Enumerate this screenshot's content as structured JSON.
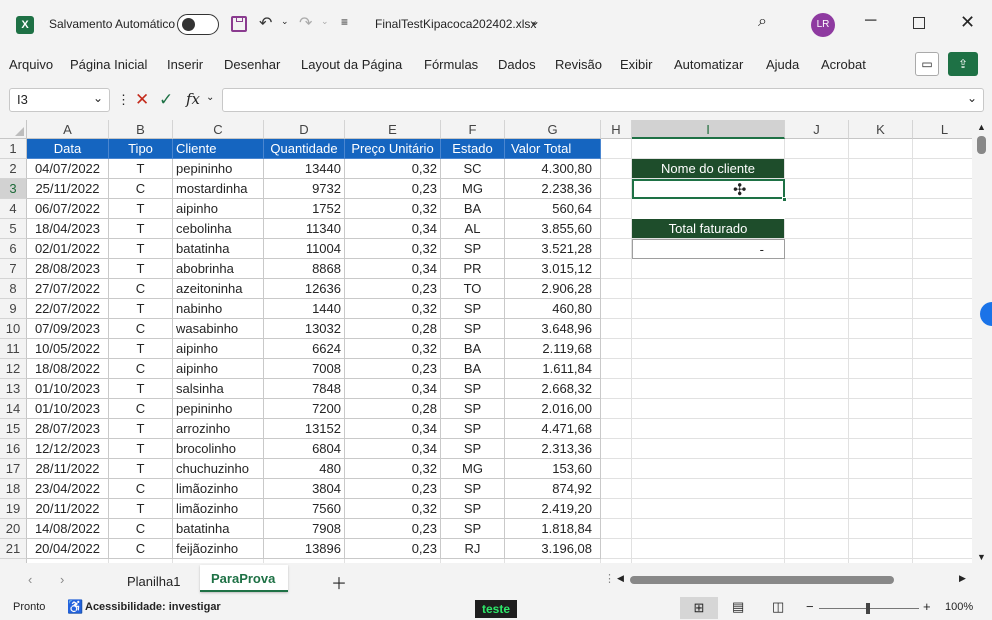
{
  "titlebar": {
    "autosave_label": "Salvamento Automático",
    "autosave_state": "Desativado",
    "filename": "FinalTestKipacoca202402.xlsx",
    "user_initials": "LR"
  },
  "menu": [
    "Arquivo",
    "Página Inicial",
    "Inserir",
    "Desenhar",
    "Layout da Página",
    "Fórmulas",
    "Dados",
    "Revisão",
    "Exibir",
    "Automatizar",
    "Ajuda",
    "Acrobat"
  ],
  "formula": {
    "namebox": "I3",
    "fx_label": "fx",
    "content": ""
  },
  "columns": [
    "A",
    "B",
    "C",
    "D",
    "E",
    "F",
    "G",
    "H",
    "I",
    "J",
    "K",
    "L"
  ],
  "table": {
    "headers": [
      "Data",
      "Tipo",
      "Cliente",
      "Quantidade",
      "Preço Unitário",
      "Estado",
      "Valor Total"
    ],
    "rows": [
      [
        "04/07/2022",
        "T",
        "pepininho",
        "13440",
        "0,32",
        "SC",
        "4.300,80"
      ],
      [
        "25/11/2022",
        "C",
        "mostardinha",
        "9732",
        "0,23",
        "MG",
        "2.238,36"
      ],
      [
        "06/07/2022",
        "T",
        "aipinho",
        "1752",
        "0,32",
        "BA",
        "560,64"
      ],
      [
        "18/04/2023",
        "T",
        "cebolinha",
        "11340",
        "0,34",
        "AL",
        "3.855,60"
      ],
      [
        "02/01/2022",
        "T",
        "batatinha",
        "11004",
        "0,32",
        "SP",
        "3.521,28"
      ],
      [
        "28/08/2023",
        "T",
        "abobrinha",
        "8868",
        "0,34",
        "PR",
        "3.015,12"
      ],
      [
        "27/07/2022",
        "C",
        "azeitoninha",
        "12636",
        "0,23",
        "TO",
        "2.906,28"
      ],
      [
        "22/07/2022",
        "T",
        "nabinho",
        "1440",
        "0,32",
        "SP",
        "460,80"
      ],
      [
        "07/09/2023",
        "C",
        "wasabinho",
        "13032",
        "0,28",
        "SP",
        "3.648,96"
      ],
      [
        "10/05/2022",
        "T",
        "aipinho",
        "6624",
        "0,32",
        "BA",
        "2.119,68"
      ],
      [
        "18/08/2022",
        "C",
        "aipinho",
        "7008",
        "0,23",
        "BA",
        "1.611,84"
      ],
      [
        "01/10/2023",
        "T",
        "salsinha",
        "7848",
        "0,34",
        "SP",
        "2.668,32"
      ],
      [
        "01/10/2023",
        "C",
        "pepininho",
        "7200",
        "0,28",
        "SP",
        "2.016,00"
      ],
      [
        "28/07/2023",
        "T",
        "arrozinho",
        "13152",
        "0,34",
        "SP",
        "4.471,68"
      ],
      [
        "12/12/2023",
        "T",
        "brocolinho",
        "6804",
        "0,34",
        "SP",
        "2.313,36"
      ],
      [
        "28/11/2022",
        "T",
        "chuchuzinho",
        "480",
        "0,32",
        "MG",
        "153,60"
      ],
      [
        "23/04/2022",
        "C",
        "limãozinho",
        "3804",
        "0,23",
        "SP",
        "874,92"
      ],
      [
        "20/11/2022",
        "T",
        "limãozinho",
        "7560",
        "0,32",
        "SP",
        "2.419,20"
      ],
      [
        "14/08/2022",
        "C",
        "batatinha",
        "7908",
        "0,23",
        "SP",
        "1.818,84"
      ],
      [
        "20/04/2022",
        "C",
        "feijãozinho",
        "13896",
        "0,23",
        "RJ",
        "3.196,08"
      ]
    ]
  },
  "side_panel": {
    "client_label": "Nome do cliente",
    "client_value": "",
    "total_label": "Total faturado",
    "total_value": "-"
  },
  "sheets": {
    "tabs": [
      "Planilha1",
      "ParaProva"
    ],
    "active": "ParaProva"
  },
  "status": {
    "mode": "Pronto",
    "accessibility": "Acessibilidade: investigar",
    "macro_badge": "teste",
    "zoom": "100%"
  },
  "colors": {
    "accent": "#1e7145",
    "table_header": "#1565c0",
    "panel_header": "#1e4d2b"
  }
}
